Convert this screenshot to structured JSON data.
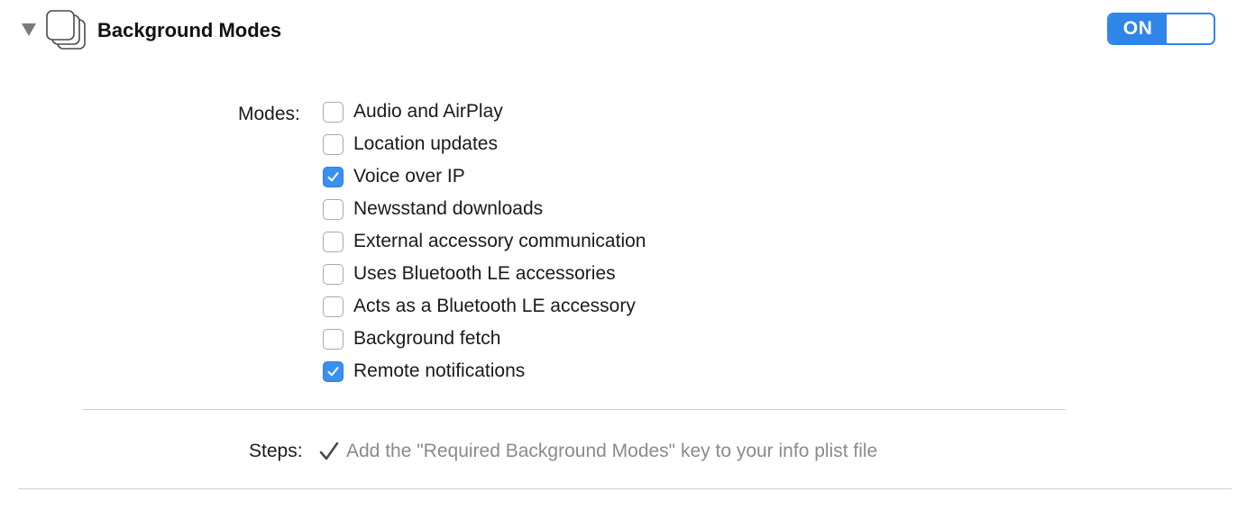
{
  "section": {
    "title": "Background Modes",
    "icon": "background-modes-icon",
    "toggle": {
      "label": "ON",
      "state": true,
      "color": "#2f86e8"
    }
  },
  "modes": {
    "label": "Modes:",
    "items": [
      {
        "label": "Audio and AirPlay",
        "checked": false
      },
      {
        "label": "Location updates",
        "checked": false
      },
      {
        "label": "Voice over IP",
        "checked": true
      },
      {
        "label": "Newsstand downloads",
        "checked": false
      },
      {
        "label": "External accessory communication",
        "checked": false
      },
      {
        "label": "Uses Bluetooth LE accessories",
        "checked": false
      },
      {
        "label": "Acts as a Bluetooth LE accessory",
        "checked": false
      },
      {
        "label": "Background fetch",
        "checked": false
      },
      {
        "label": "Remote notifications",
        "checked": true
      }
    ]
  },
  "steps": {
    "label": "Steps:",
    "items": [
      {
        "text": "Add the \"Required Background Modes\" key to your info plist file",
        "done": true
      }
    ]
  }
}
